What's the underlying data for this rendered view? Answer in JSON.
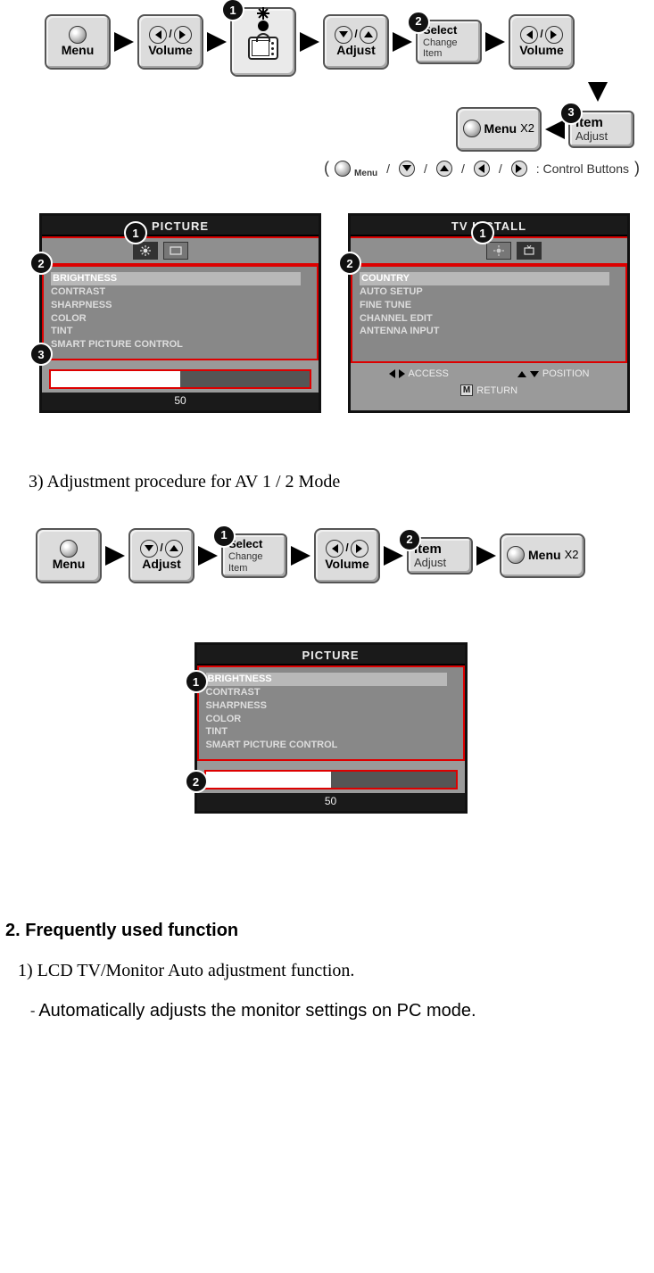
{
  "buttons": {
    "menu": "Menu",
    "volume": "Volume",
    "adjust": "Adjust",
    "menu_x2": "Menu",
    "x2_suffix": "X2"
  },
  "select_box": {
    "line1": "Select",
    "line2": "Change",
    "line3": "Item"
  },
  "item_adjust": {
    "line1": "Item",
    "line2": "Adjust"
  },
  "legend": {
    "label": ": Control Buttons",
    "menu": "Menu"
  },
  "osd_picture": {
    "title": "PICTURE",
    "items": [
      "BRIGHTNESS",
      "CONTRAST",
      "SHARPNESS",
      "COLOR",
      "TINT",
      "SMART PICTURE CONTROL"
    ],
    "slider_value": "50",
    "slider_fill_pct": 50
  },
  "osd_tv": {
    "title": "TV  INSTALL",
    "items": [
      "COUNTRY",
      "AUTO SETUP",
      "FINE TUNE",
      "CHANNEL EDIT",
      "ANTENNA INPUT"
    ],
    "footer_access": "ACCESS",
    "footer_position": "POSITION",
    "footer_return_key": "M",
    "footer_return": "RETURN"
  },
  "text": {
    "step3": "3) Adjustment procedure for AV 1 / 2 Mode",
    "heading2": "2. Frequently used function",
    "sub1": "1) LCD TV/Monitor Auto adjustment function.",
    "bullet1": "Automatically adjusts the monitor settings on PC mode."
  },
  "badges": {
    "b1": "1",
    "b2": "2",
    "b3": "3"
  }
}
